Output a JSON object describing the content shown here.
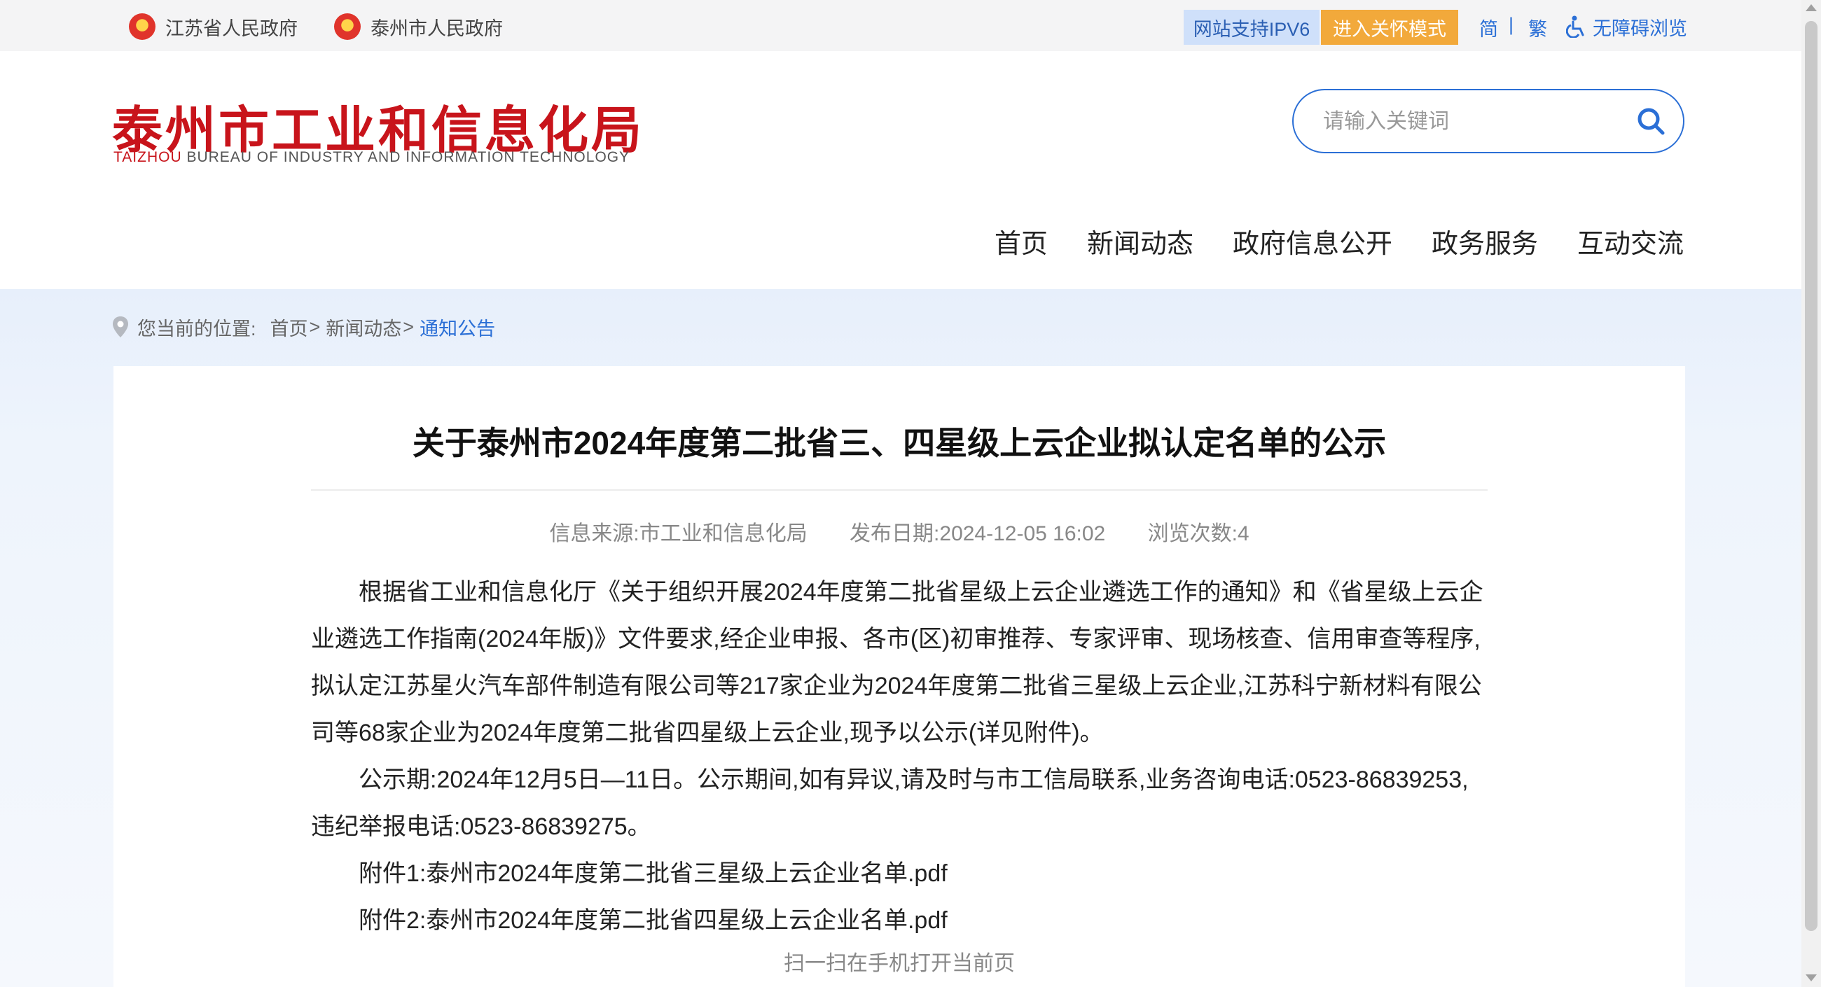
{
  "topbar": {
    "gov_links": [
      "江苏省人民政府",
      "泰州市人民政府"
    ],
    "ipv6": "网站支持IPV6",
    "care_mode": "进入关怀模式",
    "simplified": "简",
    "separator": "|",
    "traditional": "繁",
    "accessibility": "无障碍浏览"
  },
  "header": {
    "logo_cn": "泰州市工业和信息化局",
    "logo_en_red": "TAIZHOU",
    "logo_en_rest": " BUREAU OF INDUSTRY AND INFORMATION TECHNOLOGY",
    "search_placeholder": "请输入关键词"
  },
  "nav": [
    "首页",
    "新闻动态",
    "政府信息公开",
    "政务服务",
    "互动交流"
  ],
  "breadcrumb": {
    "prefix": "您当前的位置:",
    "items": [
      "首页",
      "新闻动态"
    ],
    "gt": ">",
    "current": "通知公告"
  },
  "article": {
    "title": "关于泰州市2024年度第二批省三、四星级上云企业拟认定名单的公示",
    "source": "信息来源:市工业和信息化局",
    "date": "发布日期:2024-12-05 16:02",
    "views": "浏览次数:4",
    "paragraphs": [
      "根据省工业和信息化厅《关于组织开展2024年度第二批省星级上云企业遴选工作的通知》和《省星级上云企业遴选工作指南(2024年版)》文件要求,经企业申报、各市(区)初审推荐、专家评审、现场核查、信用审查等程序,拟认定江苏星火汽车部件制造有限公司等217家企业为2024年度第二批省三星级上云企业,江苏科宁新材料有限公司等68家企业为2024年度第二批省四星级上云企业,现予以公示(详见附件)。",
      "公示期:2024年12月5日—11日。公示期间,如有异议,请及时与市工信局联系,业务咨询电话:0523-86839253,违纪举报电话:0523-86839275。"
    ],
    "attachments": [
      "附件1:泰州市2024年度第二批省三星级上云企业名单.pdf",
      "附件2:泰州市2024年度第二批省四星级上云企业名单.pdf"
    ],
    "qr_hint": "扫一扫在手机打开当前页"
  },
  "colors": {
    "brand_red": "#c8141b",
    "link_blue": "#2b6fd6",
    "care_orange": "#f2a93b",
    "ipv6_bg": "#cfe0fa"
  },
  "icons": [
    "national-emblem-icon",
    "accessibility-icon",
    "search-icon",
    "location-pin-icon"
  ]
}
